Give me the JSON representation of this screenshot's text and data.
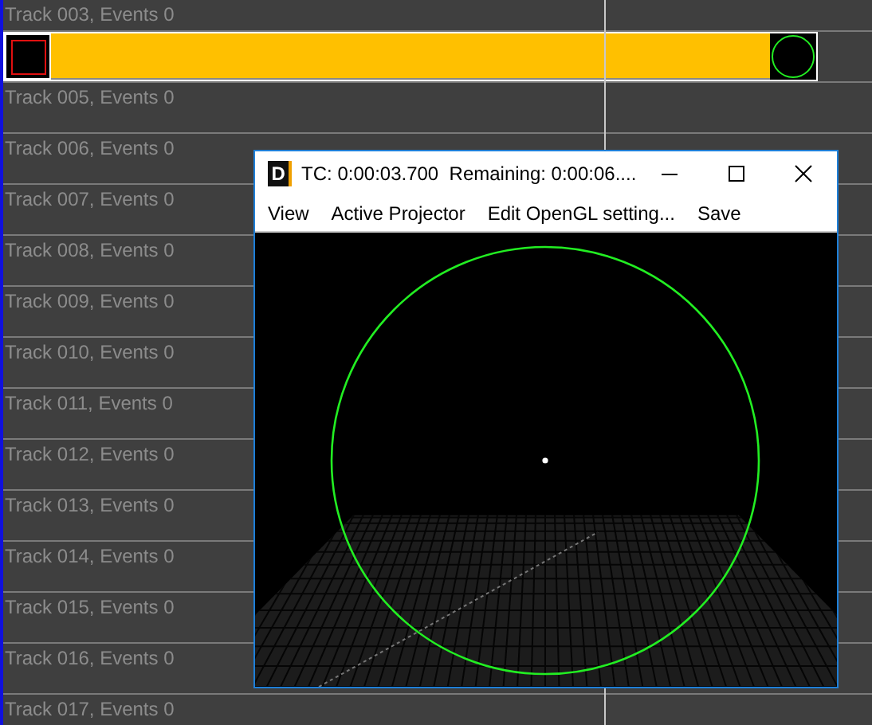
{
  "tracks": [
    {
      "kind": "label",
      "label": "Track 003, Events 0"
    },
    {
      "kind": "clip"
    },
    {
      "kind": "label",
      "label": "Track 005, Events 0"
    },
    {
      "kind": "label",
      "label": "Track 006, Events 0"
    },
    {
      "kind": "label",
      "label": "Track 007, Events 0"
    },
    {
      "kind": "label",
      "label": "Track 008, Events 0"
    },
    {
      "kind": "label",
      "label": "Track 009, Events 0"
    },
    {
      "kind": "label",
      "label": "Track 010, Events 0"
    },
    {
      "kind": "label",
      "label": "Track 011, Events 0"
    },
    {
      "kind": "label",
      "label": "Track 012, Events 0"
    },
    {
      "kind": "label",
      "label": "Track 013, Events 0"
    },
    {
      "kind": "label",
      "label": "Track 014, Events 0"
    },
    {
      "kind": "label",
      "label": "Track 015, Events 0"
    },
    {
      "kind": "label",
      "label": "Track 016, Events 0"
    },
    {
      "kind": "label",
      "label": "Track 017, Events 0"
    }
  ],
  "projector_window": {
    "app_icon_letter": "D",
    "title": "TC: 0:00:03.700  Remaining: 0:00:06....",
    "menu": [
      "View",
      "Active Projector",
      "Edit OpenGL setting...",
      "Save"
    ]
  }
}
